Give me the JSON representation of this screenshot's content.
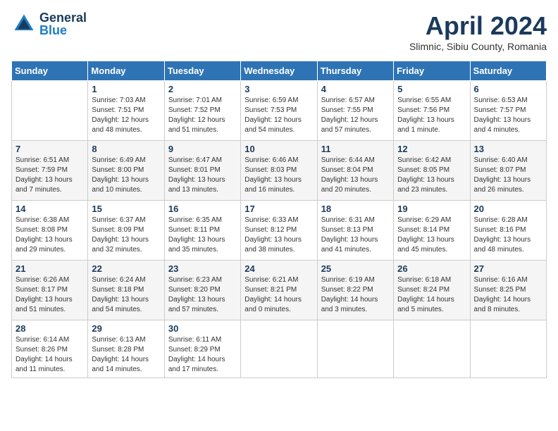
{
  "logo": {
    "general": "General",
    "blue": "Blue"
  },
  "title": "April 2024",
  "subtitle": "Slimnic, Sibiu County, Romania",
  "weekdays": [
    "Sunday",
    "Monday",
    "Tuesday",
    "Wednesday",
    "Thursday",
    "Friday",
    "Saturday"
  ],
  "weeks": [
    [
      {
        "day": "",
        "content": ""
      },
      {
        "day": "1",
        "content": "Sunrise: 7:03 AM\nSunset: 7:51 PM\nDaylight: 12 hours\nand 48 minutes."
      },
      {
        "day": "2",
        "content": "Sunrise: 7:01 AM\nSunset: 7:52 PM\nDaylight: 12 hours\nand 51 minutes."
      },
      {
        "day": "3",
        "content": "Sunrise: 6:59 AM\nSunset: 7:53 PM\nDaylight: 12 hours\nand 54 minutes."
      },
      {
        "day": "4",
        "content": "Sunrise: 6:57 AM\nSunset: 7:55 PM\nDaylight: 12 hours\nand 57 minutes."
      },
      {
        "day": "5",
        "content": "Sunrise: 6:55 AM\nSunset: 7:56 PM\nDaylight: 13 hours\nand 1 minute."
      },
      {
        "day": "6",
        "content": "Sunrise: 6:53 AM\nSunset: 7:57 PM\nDaylight: 13 hours\nand 4 minutes."
      }
    ],
    [
      {
        "day": "7",
        "content": "Sunrise: 6:51 AM\nSunset: 7:59 PM\nDaylight: 13 hours\nand 7 minutes."
      },
      {
        "day": "8",
        "content": "Sunrise: 6:49 AM\nSunset: 8:00 PM\nDaylight: 13 hours\nand 10 minutes."
      },
      {
        "day": "9",
        "content": "Sunrise: 6:47 AM\nSunset: 8:01 PM\nDaylight: 13 hours\nand 13 minutes."
      },
      {
        "day": "10",
        "content": "Sunrise: 6:46 AM\nSunset: 8:03 PM\nDaylight: 13 hours\nand 16 minutes."
      },
      {
        "day": "11",
        "content": "Sunrise: 6:44 AM\nSunset: 8:04 PM\nDaylight: 13 hours\nand 20 minutes."
      },
      {
        "day": "12",
        "content": "Sunrise: 6:42 AM\nSunset: 8:05 PM\nDaylight: 13 hours\nand 23 minutes."
      },
      {
        "day": "13",
        "content": "Sunrise: 6:40 AM\nSunset: 8:07 PM\nDaylight: 13 hours\nand 26 minutes."
      }
    ],
    [
      {
        "day": "14",
        "content": "Sunrise: 6:38 AM\nSunset: 8:08 PM\nDaylight: 13 hours\nand 29 minutes."
      },
      {
        "day": "15",
        "content": "Sunrise: 6:37 AM\nSunset: 8:09 PM\nDaylight: 13 hours\nand 32 minutes."
      },
      {
        "day": "16",
        "content": "Sunrise: 6:35 AM\nSunset: 8:11 PM\nDaylight: 13 hours\nand 35 minutes."
      },
      {
        "day": "17",
        "content": "Sunrise: 6:33 AM\nSunset: 8:12 PM\nDaylight: 13 hours\nand 38 minutes."
      },
      {
        "day": "18",
        "content": "Sunrise: 6:31 AM\nSunset: 8:13 PM\nDaylight: 13 hours\nand 41 minutes."
      },
      {
        "day": "19",
        "content": "Sunrise: 6:29 AM\nSunset: 8:14 PM\nDaylight: 13 hours\nand 45 minutes."
      },
      {
        "day": "20",
        "content": "Sunrise: 6:28 AM\nSunset: 8:16 PM\nDaylight: 13 hours\nand 48 minutes."
      }
    ],
    [
      {
        "day": "21",
        "content": "Sunrise: 6:26 AM\nSunset: 8:17 PM\nDaylight: 13 hours\nand 51 minutes."
      },
      {
        "day": "22",
        "content": "Sunrise: 6:24 AM\nSunset: 8:18 PM\nDaylight: 13 hours\nand 54 minutes."
      },
      {
        "day": "23",
        "content": "Sunrise: 6:23 AM\nSunset: 8:20 PM\nDaylight: 13 hours\nand 57 minutes."
      },
      {
        "day": "24",
        "content": "Sunrise: 6:21 AM\nSunset: 8:21 PM\nDaylight: 14 hours\nand 0 minutes."
      },
      {
        "day": "25",
        "content": "Sunrise: 6:19 AM\nSunset: 8:22 PM\nDaylight: 14 hours\nand 3 minutes."
      },
      {
        "day": "26",
        "content": "Sunrise: 6:18 AM\nSunset: 8:24 PM\nDaylight: 14 hours\nand 5 minutes."
      },
      {
        "day": "27",
        "content": "Sunrise: 6:16 AM\nSunset: 8:25 PM\nDaylight: 14 hours\nand 8 minutes."
      }
    ],
    [
      {
        "day": "28",
        "content": "Sunrise: 6:14 AM\nSunset: 8:26 PM\nDaylight: 14 hours\nand 11 minutes."
      },
      {
        "day": "29",
        "content": "Sunrise: 6:13 AM\nSunset: 8:28 PM\nDaylight: 14 hours\nand 14 minutes."
      },
      {
        "day": "30",
        "content": "Sunrise: 6:11 AM\nSunset: 8:29 PM\nDaylight: 14 hours\nand 17 minutes."
      },
      {
        "day": "",
        "content": ""
      },
      {
        "day": "",
        "content": ""
      },
      {
        "day": "",
        "content": ""
      },
      {
        "day": "",
        "content": ""
      }
    ]
  ]
}
